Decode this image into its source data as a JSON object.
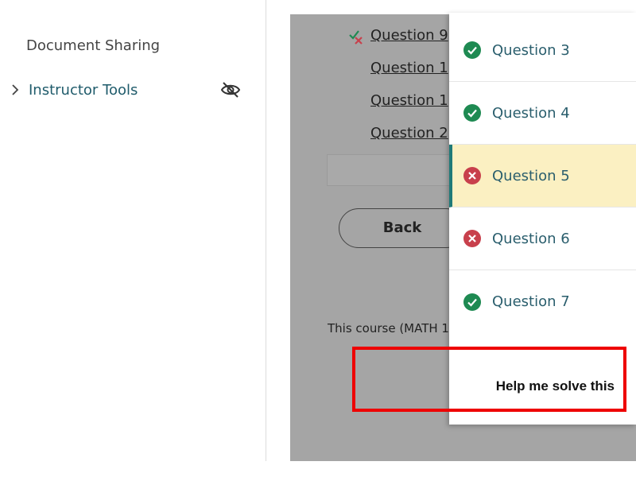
{
  "sidebar": {
    "items": [
      {
        "label": "Document Sharing"
      },
      {
        "label": "Instructor Tools",
        "icon": "chevron-right-icon",
        "trailing_icon": "eye-off-icon"
      }
    ]
  },
  "main": {
    "question_links": [
      {
        "label": "Question 9"
      },
      {
        "label": "Question 1"
      },
      {
        "label": "Question 1"
      },
      {
        "label": "Question 2"
      }
    ],
    "back_label": "Back",
    "course_text": "This course (MATH 1"
  },
  "dropdown": {
    "items": [
      {
        "label": "Question 3",
        "status": "correct"
      },
      {
        "label": "Question 4",
        "status": "correct"
      },
      {
        "label": "Question 5",
        "status": "incorrect",
        "active": true
      },
      {
        "label": "Question 6",
        "status": "incorrect"
      },
      {
        "label": "Question 7",
        "status": "correct"
      }
    ],
    "help_label": "Help me solve this"
  },
  "colors": {
    "correct": "#1e8a52",
    "incorrect": "#c8404c",
    "highlight": "#ee0000",
    "active_bg": "#fbf0c2",
    "accent": "#1f7a78"
  }
}
